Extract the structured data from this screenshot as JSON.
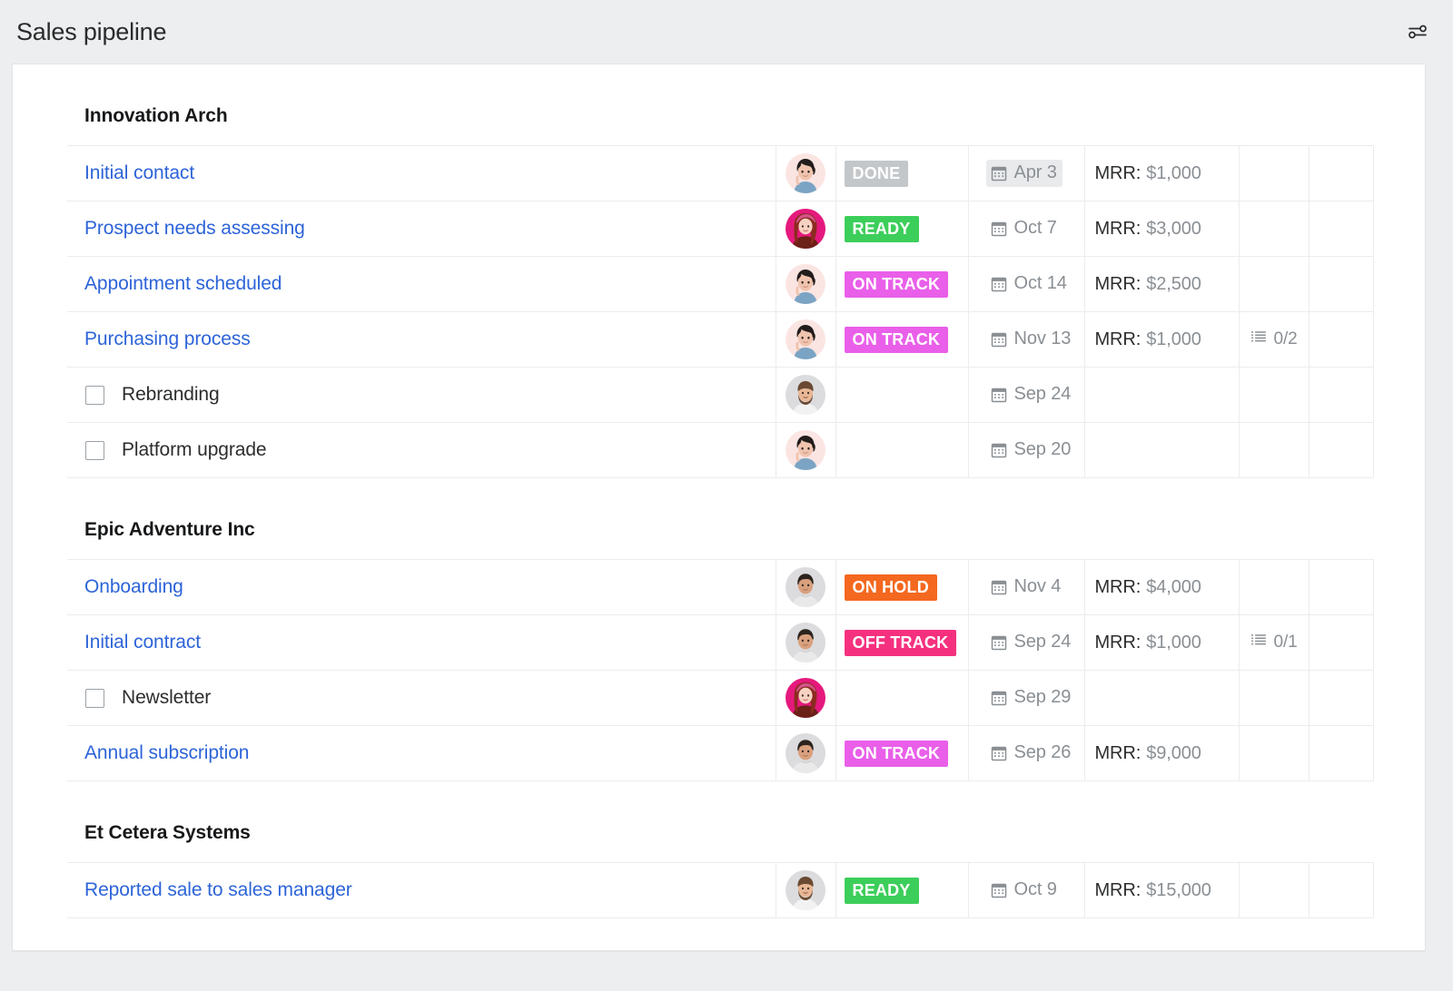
{
  "header": {
    "title": "Sales pipeline",
    "settings_icon": "sliders-icon"
  },
  "groups": [
    {
      "title": "Innovation Arch",
      "rows": [
        {
          "type": "link",
          "name": "Initial contact",
          "avatar": "woman-dark-hair",
          "status": "DONE",
          "status_color": "#c4c7c9",
          "date": "Apr 3",
          "date_shaded": true,
          "mrr_label": "MRR:",
          "mrr_value": "$1,000",
          "checklist": ""
        },
        {
          "type": "link",
          "name": "Prospect needs assessing",
          "avatar": "woman-pink-hair",
          "status": "READY",
          "status_color": "#3cce5a",
          "date": "Oct 7",
          "date_shaded": false,
          "mrr_label": "MRR:",
          "mrr_value": "$3,000",
          "checklist": ""
        },
        {
          "type": "link",
          "name": "Appointment scheduled",
          "avatar": "woman-dark-hair",
          "status": "ON TRACK",
          "status_color": "#e95fe9",
          "date": "Oct 14",
          "date_shaded": false,
          "mrr_label": "MRR:",
          "mrr_value": "$2,500",
          "checklist": ""
        },
        {
          "type": "link",
          "name": "Purchasing process",
          "avatar": "woman-dark-hair",
          "status": "ON TRACK",
          "status_color": "#e95fe9",
          "date": "Nov 13",
          "date_shaded": false,
          "mrr_label": "MRR:",
          "mrr_value": "$1,000",
          "checklist": "0/2"
        },
        {
          "type": "checkitem",
          "name": "Rebranding",
          "avatar": "man-beard",
          "status": "",
          "status_color": "",
          "date": "Sep 24",
          "date_shaded": false,
          "mrr_label": "",
          "mrr_value": "",
          "checklist": ""
        },
        {
          "type": "checkitem",
          "name": "Platform upgrade",
          "avatar": "woman-dark-hair",
          "status": "",
          "status_color": "",
          "date": "Sep 20",
          "date_shaded": false,
          "mrr_label": "",
          "mrr_value": "",
          "checklist": ""
        }
      ]
    },
    {
      "title": "Epic Adventure Inc",
      "rows": [
        {
          "type": "link",
          "name": "Onboarding",
          "avatar": "man-short-hair",
          "status": "ON HOLD",
          "status_color": "#f4681f",
          "date": "Nov 4",
          "date_shaded": false,
          "mrr_label": "MRR:",
          "mrr_value": "$4,000",
          "checklist": ""
        },
        {
          "type": "link",
          "name": "Initial contract",
          "avatar": "man-short-hair",
          "status": "OFF TRACK",
          "status_color": "#f5317f",
          "date": "Sep 24",
          "date_shaded": false,
          "mrr_label": "MRR:",
          "mrr_value": "$1,000",
          "checklist": "0/1"
        },
        {
          "type": "checkitem",
          "name": "Newsletter",
          "avatar": "woman-pink-hair",
          "status": "",
          "status_color": "",
          "date": "Sep 29",
          "date_shaded": false,
          "mrr_label": "",
          "mrr_value": "",
          "checklist": ""
        },
        {
          "type": "link",
          "name": "Annual subscription",
          "avatar": "man-short-hair",
          "status": "ON TRACK",
          "status_color": "#e95fe9",
          "date": "Sep 26",
          "date_shaded": false,
          "mrr_label": "MRR:",
          "mrr_value": "$9,000",
          "checklist": ""
        }
      ]
    },
    {
      "title": "Et Cetera Systems",
      "rows": [
        {
          "type": "link",
          "name": "Reported sale to sales manager",
          "avatar": "man-beard",
          "status": "READY",
          "status_color": "#3cce5a",
          "date": "Oct 9",
          "date_shaded": false,
          "mrr_label": "MRR:",
          "mrr_value": "$15,000",
          "checklist": ""
        }
      ]
    }
  ],
  "icons": {
    "calendar": "calendar-icon",
    "checklist": "checklist-icon",
    "checkbox": "checkbox-unchecked-icon"
  },
  "colors": {
    "link": "#2d64d8",
    "page_bg": "#eceef0",
    "card_bg": "#ffffff",
    "border": "#ebecee",
    "muted_text": "#8a8f94"
  }
}
